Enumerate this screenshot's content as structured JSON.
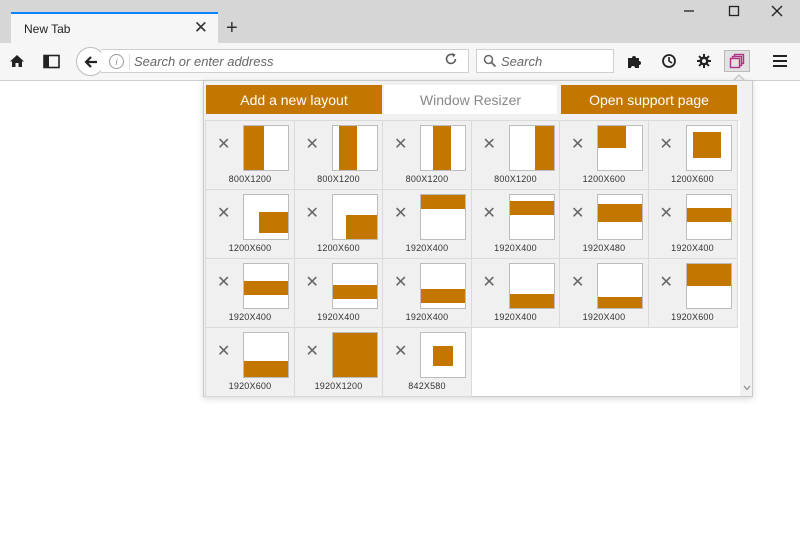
{
  "browser": {
    "tab_title": "New Tab",
    "tab_close": "✕",
    "new_tab": "+",
    "url_placeholder": "Search or enter address",
    "search_placeholder": "Search"
  },
  "popup": {
    "add_layout_label": "Add a new layout",
    "title": "Window Resizer",
    "support_label": "Open support page",
    "delete_symbol": "✕",
    "accent_color": "#c47700",
    "layouts": [
      {
        "label": "800X1200"
      },
      {
        "label": "800X1200"
      },
      {
        "label": "800X1200"
      },
      {
        "label": "800X1200"
      },
      {
        "label": "1200X600"
      },
      {
        "label": "1200X600"
      },
      {
        "label": "1200X600"
      },
      {
        "label": "1200X600"
      },
      {
        "label": "1920X400"
      },
      {
        "label": "1920X400"
      },
      {
        "label": "1920X480"
      },
      {
        "label": "1920X400"
      },
      {
        "label": "1920X400"
      },
      {
        "label": "1920X400"
      },
      {
        "label": "1920X400"
      },
      {
        "label": "1920X400"
      },
      {
        "label": "1920X400"
      },
      {
        "label": "1920X600"
      },
      {
        "label": "1920X600"
      },
      {
        "label": "1920X1200"
      },
      {
        "label": "842X580"
      }
    ]
  }
}
